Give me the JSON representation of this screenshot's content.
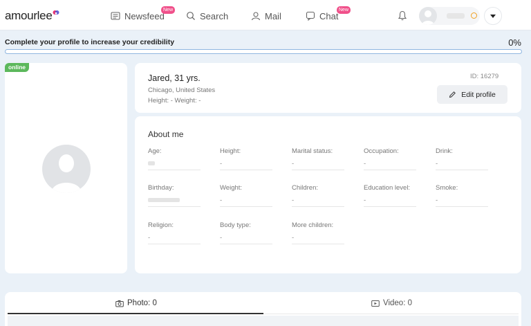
{
  "header": {
    "logo": "amourlee",
    "nav": [
      {
        "label": "Newsfeed",
        "badge": "New",
        "icon": "newsfeed-icon"
      },
      {
        "label": "Search",
        "badge": "",
        "icon": "search-icon"
      },
      {
        "label": "Mail",
        "badge": "",
        "icon": "mail-icon"
      },
      {
        "label": "Chat",
        "badge": "New",
        "icon": "chat-icon"
      }
    ],
    "notification_icon": "bell-icon",
    "accent_color": "#f0508a"
  },
  "progress": {
    "text": "Complete your profile to increase your credibility",
    "percent_label": "0%",
    "value": 0
  },
  "profile": {
    "online_label": "online",
    "name": "Jared, 31 yrs.",
    "location": "Chicago, United States",
    "height_weight": "Height: -   Weight: -",
    "id_label": "ID: 16279",
    "edit_label": "Edit profile"
  },
  "about": {
    "title": "About me",
    "fields": [
      {
        "label": "Age:",
        "value": ""
      },
      {
        "label": "Height:",
        "value": "-"
      },
      {
        "label": "Marital status:",
        "value": "-"
      },
      {
        "label": "Occupation:",
        "value": "-"
      },
      {
        "label": "Drink:",
        "value": "-"
      },
      {
        "label": "Birthday:",
        "value": ""
      },
      {
        "label": "Weight:",
        "value": "-"
      },
      {
        "label": "Children:",
        "value": "-"
      },
      {
        "label": "Education level:",
        "value": "-"
      },
      {
        "label": "Smoke:",
        "value": "-"
      },
      {
        "label": "Religion:",
        "value": "-"
      },
      {
        "label": "Body type:",
        "value": "-"
      },
      {
        "label": "More children:",
        "value": "-"
      }
    ]
  },
  "media": {
    "tabs": [
      {
        "label": "Photo: 0",
        "icon": "camera-icon"
      },
      {
        "label": "Video: 0",
        "icon": "video-icon"
      }
    ]
  }
}
